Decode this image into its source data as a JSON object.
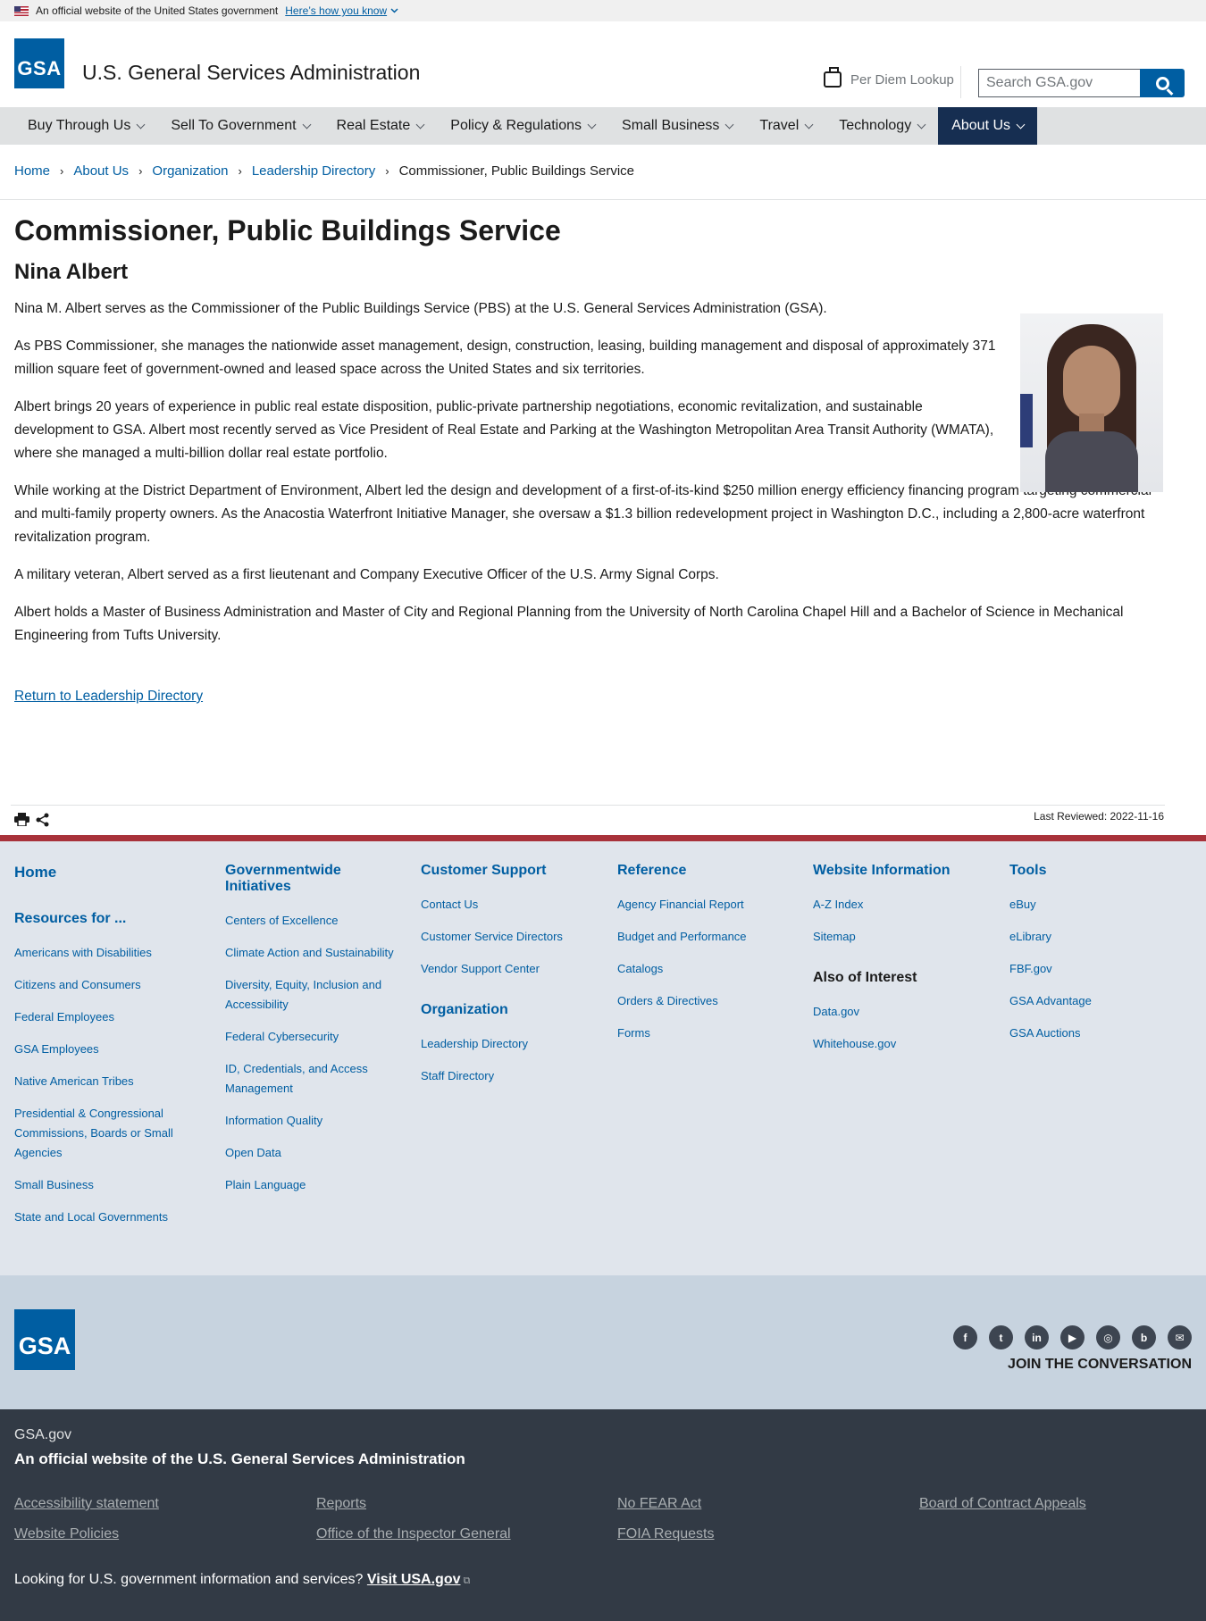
{
  "gov_banner": {
    "text": "An official website of the United States government",
    "link": "Here’s how you know"
  },
  "header": {
    "logo_text": "GSA",
    "site_title": "U.S. General Services Administration",
    "per_diem": "Per Diem Lookup",
    "search_placeholder": "Search GSA.gov"
  },
  "nav": {
    "items": [
      "Buy Through Us",
      "Sell To Government",
      "Real Estate",
      "Policy & Regulations",
      "Small Business",
      "Travel",
      "Technology",
      "About Us"
    ],
    "active": "About Us"
  },
  "breadcrumb": [
    "Home",
    "About Us",
    "Organization",
    "Leadership Directory",
    "Commissioner, Public Buildings Service"
  ],
  "main": {
    "title": "Commissioner, Public Buildings Service",
    "name": "Nina Albert",
    "paragraphs": [
      "Nina M. Albert serves as the Commissioner of the Public Buildings Service (PBS) at the U.S. General Services Administration (GSA).",
      "As PBS Commissioner, she manages the nationwide asset management, design, construction, leasing, building management and disposal of approximately 371 million square feet of government-owned and leased space across the United States and six territories.",
      "Albert brings 20 years of experience in public real estate disposition, public-private partnership negotiations, economic revitalization, and sustainable development to GSA. Albert most recently served as Vice President of Real Estate and Parking at the Washington Metropolitan Area Transit Authority (WMATA), where she managed a multi-billion dollar real estate portfolio.",
      "While working at the District Department of Environment, Albert led the design and development of a first-of-its-kind $250 million energy efficiency financing program targeting commercial and multi-family property owners. As the Anacostia Waterfront Initiative Manager, she oversaw a $1.3 billion redevelopment project in Washington D.C., including a 2,800-acre waterfront revitalization program.",
      "A military veteran, Albert served as a first lieutenant and Company Executive Officer of the U.S. Army Signal Corps.",
      "Albert holds a Master of Business Administration and Master of City and Regional Planning from the University of North Carolina Chapel Hill and a Bachelor of Science in Mechanical Engineering from Tufts University."
    ],
    "return_link": "Return to Leadership Directory",
    "last_reviewed": "Last Reviewed: 2022-11-16"
  },
  "footer": {
    "home": "Home",
    "resources_heading": "Resources for ...",
    "resources": [
      "Americans with Disabilities",
      "Citizens and Consumers",
      "Federal Employees",
      "GSA Employees",
      "Native American Tribes",
      "Presidential & Congressional Commissions, Boards or Small Agencies",
      "Small Business",
      "State and Local Governments"
    ],
    "govwide_heading": "Governmentwide Initiatives",
    "govwide": [
      "Centers of Excellence",
      "Climate Action and Sustainability",
      "Diversity, Equity, Inclusion and Accessibility",
      "Federal Cybersecurity",
      "ID, Credentials, and Access Management",
      "Information Quality",
      "Open Data",
      "Plain Language"
    ],
    "support_heading": "Customer Support",
    "support": [
      "Contact Us",
      "Customer Service Directors",
      "Vendor Support Center"
    ],
    "org_heading": "Organization",
    "org": [
      "Leadership Directory",
      "Staff Directory"
    ],
    "reference_heading": "Reference",
    "reference": [
      "Agency Financial Report",
      "Budget and Performance",
      "Catalogs",
      "Orders & Directives",
      "Forms"
    ],
    "website_heading": "Website Information",
    "website": [
      "A-Z Index",
      "Sitemap"
    ],
    "interest_heading": "Also of Interest",
    "interest": [
      "Data.gov",
      "Whitehouse.gov"
    ],
    "tools_heading": "Tools",
    "tools": [
      "eBuy",
      "eLibrary",
      "FBF.gov",
      "GSA Advantage",
      "GSA Auctions"
    ],
    "join": "JOIN THE CONVERSATION",
    "social_icons": [
      "facebook-icon",
      "twitter-icon",
      "linkedin-icon",
      "youtube-icon",
      "instagram-icon",
      "blog-icon",
      "email-icon"
    ],
    "site": "GSA.gov",
    "official": "An official website of the U.S. General Services Administration",
    "bottom_links": [
      "Accessibility statement",
      "Reports",
      "No FEAR Act",
      "Board of Contract Appeals",
      "Website Policies",
      "Office of the Inspector General",
      "FOIA Requests"
    ],
    "usa_text": "Looking for U.S. government information and services?",
    "usa_link": "Visit USA.gov"
  },
  "colors": {
    "primary": "#005ea2",
    "nav_active": "#162e51",
    "footer_red": "#a8323a",
    "footer_dark": "#323a45"
  }
}
